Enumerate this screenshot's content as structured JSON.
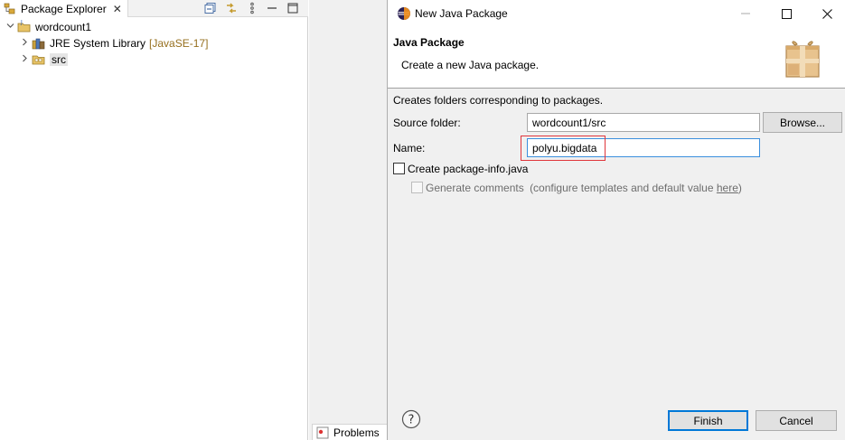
{
  "explorer": {
    "tab_label": "Package Explorer",
    "tab_close": "✕",
    "toolbar_icons": [
      "collapse-all-icon",
      "link-with-editor-icon",
      "view-menu-icon",
      "minimize-icon"
    ],
    "tree": [
      {
        "label": "wordcount1",
        "decoration": "",
        "icon": "java-project-icon",
        "twisty": "expanded"
      },
      {
        "label": "JRE System Library",
        "decoration": "[JavaSE-17]",
        "icon": "library-icon",
        "twisty": "collapsed"
      },
      {
        "label": "src",
        "decoration": "",
        "icon": "source-folder-icon",
        "twisty": "collapsed"
      }
    ]
  },
  "bottom_panel": {
    "problems_tab": "Problems"
  },
  "dialog": {
    "title": "New Java Package",
    "window_controls": [
      "minimize-icon",
      "maximize-icon",
      "close-icon"
    ],
    "header_title": "Java Package",
    "header_desc": "Create a new Java package.",
    "intro": "Creates folders corresponding to packages.",
    "source_folder_label": "Source folder:",
    "source_folder_value": "wordcount1/src",
    "browse_label": "Browse...",
    "name_label": "Name:",
    "name_value": "polyu.bigdata",
    "create_info_label": "Create package-info.java",
    "create_info_checked": false,
    "generate_comments_label": "Generate comments",
    "generate_comments_paren_open": "(configure templates and default value ",
    "generate_comments_link": "here",
    "generate_comments_paren_close": ")",
    "generate_comments_enabled": false,
    "finish_label": "Finish",
    "cancel_label": "Cancel",
    "help_icon": "help-icon"
  },
  "colors": {
    "accent": "#0078d7",
    "highlight": "#e0353b",
    "decoration": "#966f1e"
  }
}
